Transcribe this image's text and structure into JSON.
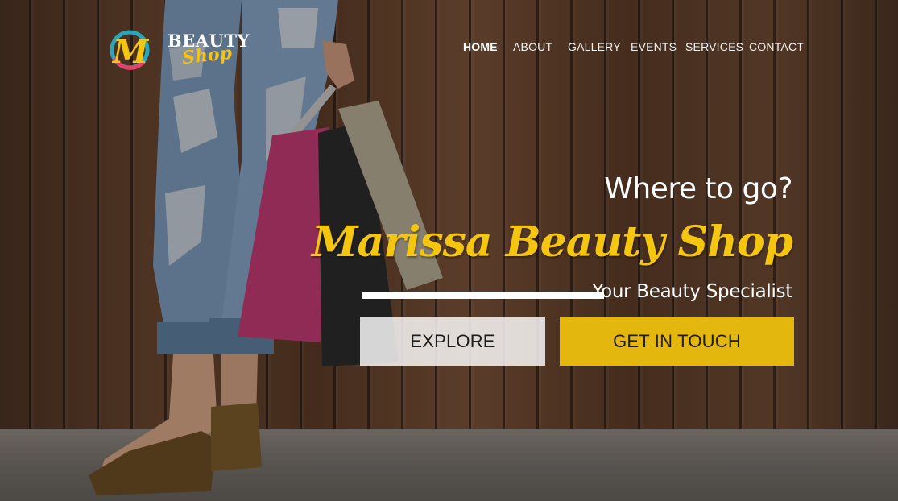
{
  "brand": {
    "logo_word": "BEAUTY",
    "logo_script": "Shop",
    "logo_monogram": "M",
    "accent_color": "#f5c60f"
  },
  "nav": {
    "items": [
      {
        "label": "HOME",
        "active": true
      },
      {
        "label": "ABOUT",
        "active": false
      },
      {
        "label": "GALLERY",
        "active": false
      },
      {
        "label": "EVENTS",
        "active": false
      },
      {
        "label": "SERVICES",
        "active": false
      },
      {
        "label": "CONTACT",
        "active": false
      }
    ]
  },
  "hero": {
    "question": "Where to go?",
    "shop_name": "Marissa Beauty Shop",
    "tagline": "Your Beauty Specialist",
    "explore_label": "EXPLORE",
    "contact_label": "GET IN TOUCH"
  }
}
